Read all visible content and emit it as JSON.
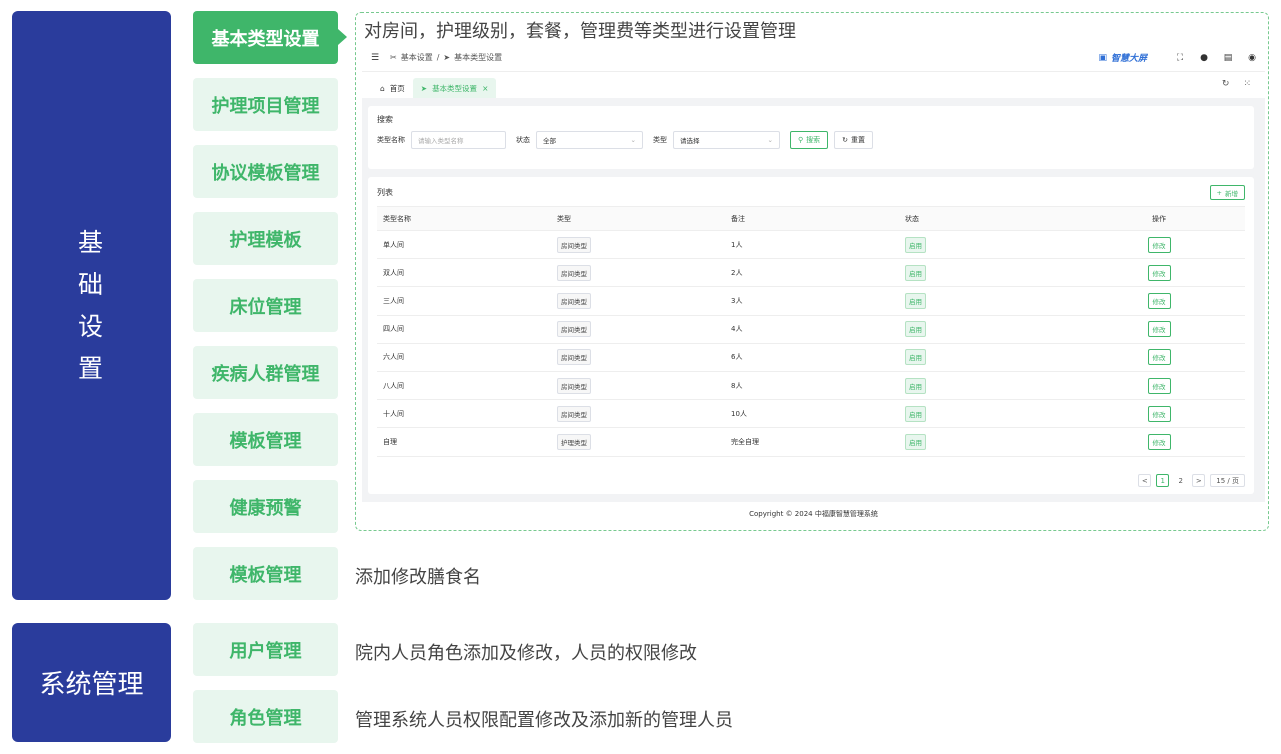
{
  "categories": {
    "basic_chars": [
      "基",
      "础",
      "设",
      "置"
    ],
    "system": "系统管理"
  },
  "menu": [
    {
      "label": "基本类型设置"
    },
    {
      "label": "护理项目管理"
    },
    {
      "label": "协议模板管理"
    },
    {
      "label": "护理模板"
    },
    {
      "label": "床位管理"
    },
    {
      "label": "疾病人群管理"
    },
    {
      "label": "模板管理"
    },
    {
      "label": "健康预警"
    },
    {
      "label": "模板管理"
    },
    {
      "label": "用户管理"
    },
    {
      "label": "角色管理"
    }
  ],
  "descriptions": {
    "basic_type": "对房间，护理级别，套餐，管理费等类型进行设置管理",
    "template": "添加修改膳食名",
    "user": "院内人员角色添加及修改，人员的权限修改",
    "role": "管理系统人员权限配置修改及添加新的管理人员"
  },
  "app": {
    "breadcrumb": [
      "基本设置",
      "/",
      "基本类型设置"
    ],
    "brand": "智慧大屏",
    "tabs": [
      {
        "label": "首页"
      },
      {
        "label": "基本类型设置",
        "close": "×"
      }
    ],
    "search": {
      "title": "搜索",
      "name_label": "类型名称",
      "name_placeholder": "请输入类型名称",
      "status_label": "状态",
      "status_value": "全部",
      "type_label": "类型",
      "type_value": "请选择",
      "search_btn": "搜索",
      "reset_btn": "重置"
    },
    "list": {
      "title": "列表",
      "add_btn": "新增",
      "columns": [
        "类型名称",
        "类型",
        "备注",
        "状态",
        "操作"
      ],
      "rows": [
        {
          "name": "单人间",
          "type": "房间类型",
          "note": "1人",
          "status": "启用",
          "op": "修改"
        },
        {
          "name": "双人间",
          "type": "房间类型",
          "note": "2人",
          "status": "启用",
          "op": "修改"
        },
        {
          "name": "三人间",
          "type": "房间类型",
          "note": "3人",
          "status": "启用",
          "op": "修改"
        },
        {
          "name": "四人间",
          "type": "房间类型",
          "note": "4人",
          "status": "启用",
          "op": "修改"
        },
        {
          "name": "六人间",
          "type": "房间类型",
          "note": "6人",
          "status": "启用",
          "op": "修改"
        },
        {
          "name": "八人间",
          "type": "房间类型",
          "note": "8人",
          "status": "启用",
          "op": "修改"
        },
        {
          "name": "十人间",
          "type": "房间类型",
          "note": "10人",
          "status": "启用",
          "op": "修改"
        },
        {
          "name": "自理",
          "type": "护理类型",
          "note": "完全自理",
          "status": "启用",
          "op": "修改"
        }
      ]
    },
    "pager": {
      "prev": "<",
      "pages": [
        "1",
        "2"
      ],
      "next": ">",
      "size": "15 / 页"
    },
    "footer": "Copyright © 2024 中福康智慧管理系统"
  },
  "colors": {
    "accent": "#3fb66a",
    "category": "#2a3c9c",
    "menu_bg": "#e8f6ee"
  }
}
